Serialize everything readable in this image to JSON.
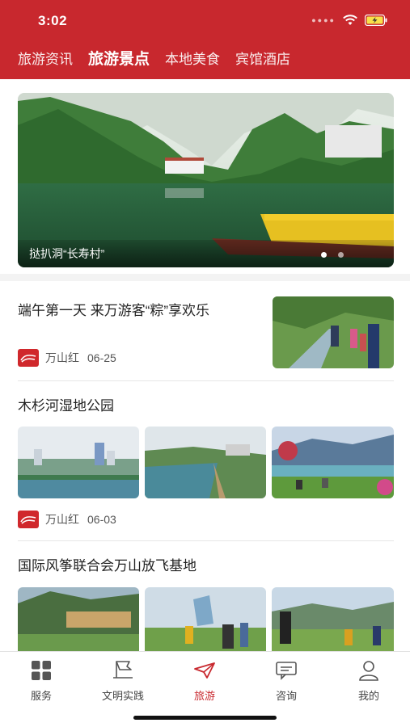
{
  "status": {
    "time": "3:02"
  },
  "header": {
    "tabs": [
      {
        "label": "旅游资讯",
        "active": false
      },
      {
        "label": "旅游景点",
        "active": true
      },
      {
        "label": "本地美食",
        "active": false
      },
      {
        "label": "宾馆酒店",
        "active": false
      }
    ],
    "bg_color": "#c8282e"
  },
  "banner": {
    "caption": "挞扒洞“长寿村”",
    "slide_count": 2,
    "active_slide": 1
  },
  "articles": [
    {
      "title": "端午第一天 来万游客“粽”享欢乐",
      "source": "万山红",
      "date": "06-25"
    },
    {
      "title": "木杉河湿地公园",
      "source": "万山红",
      "date": "06-03"
    },
    {
      "title": "国际风筝联合会万山放飞基地"
    }
  ],
  "bottom_nav": [
    {
      "label": "服务",
      "icon": "grid-icon",
      "active": false
    },
    {
      "label": "文明实践",
      "icon": "flag-icon",
      "active": false
    },
    {
      "label": "旅游",
      "icon": "paper-plane-icon",
      "active": true
    },
    {
      "label": "咨询",
      "icon": "chat-icon",
      "active": false
    },
    {
      "label": "我的",
      "icon": "user-icon",
      "active": false
    }
  ],
  "accent_color": "#c8282e"
}
